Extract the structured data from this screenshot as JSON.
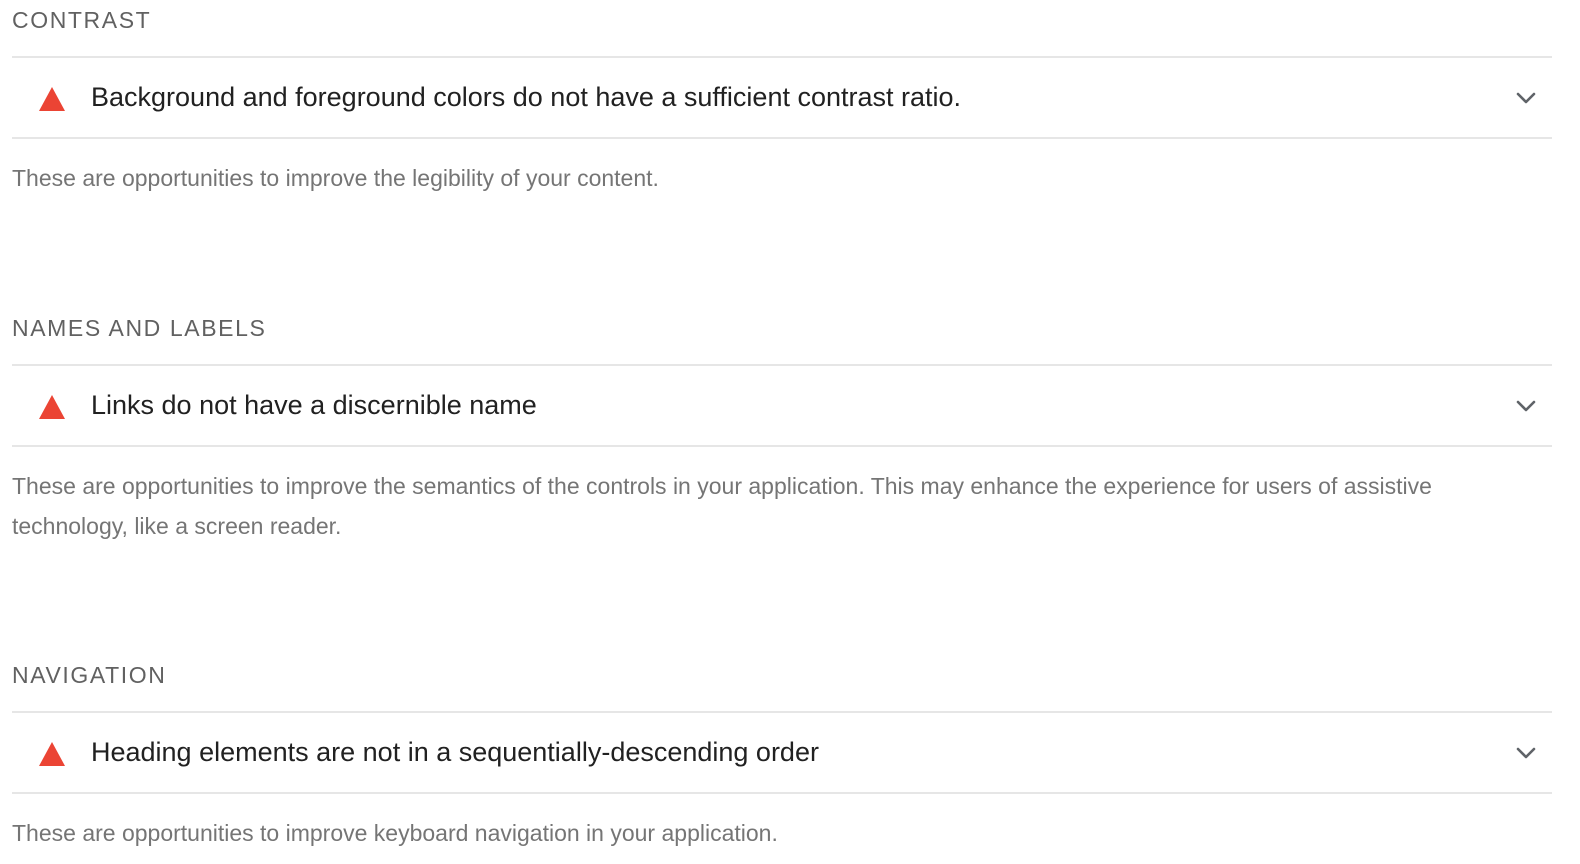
{
  "colors": {
    "fail": "#eb4434",
    "title_text": "#212121",
    "description_text": "#757575",
    "header_text": "#616161",
    "divider": "#e6e6e6"
  },
  "groups": [
    {
      "header": "CONTRAST",
      "audit_title": "Background and foreground colors do not have a sufficient contrast ratio.",
      "audit_icon": "warning-triangle-icon",
      "expand_icon": "chevron-down-icon",
      "description": "These are opportunities to improve the legibility of your content."
    },
    {
      "header": "NAMES AND LABELS",
      "audit_title": "Links do not have a discernible name",
      "audit_icon": "warning-triangle-icon",
      "expand_icon": "chevron-down-icon",
      "description": "These are opportunities to improve the semantics of the controls in your application. This may enhance the experience for users of assistive technology, like a screen reader."
    },
    {
      "header": "NAVIGATION",
      "audit_title": "Heading elements are not in a sequentially-descending order",
      "audit_icon": "warning-triangle-icon",
      "expand_icon": "chevron-down-icon",
      "description": "These are opportunities to improve keyboard navigation in your application."
    }
  ]
}
